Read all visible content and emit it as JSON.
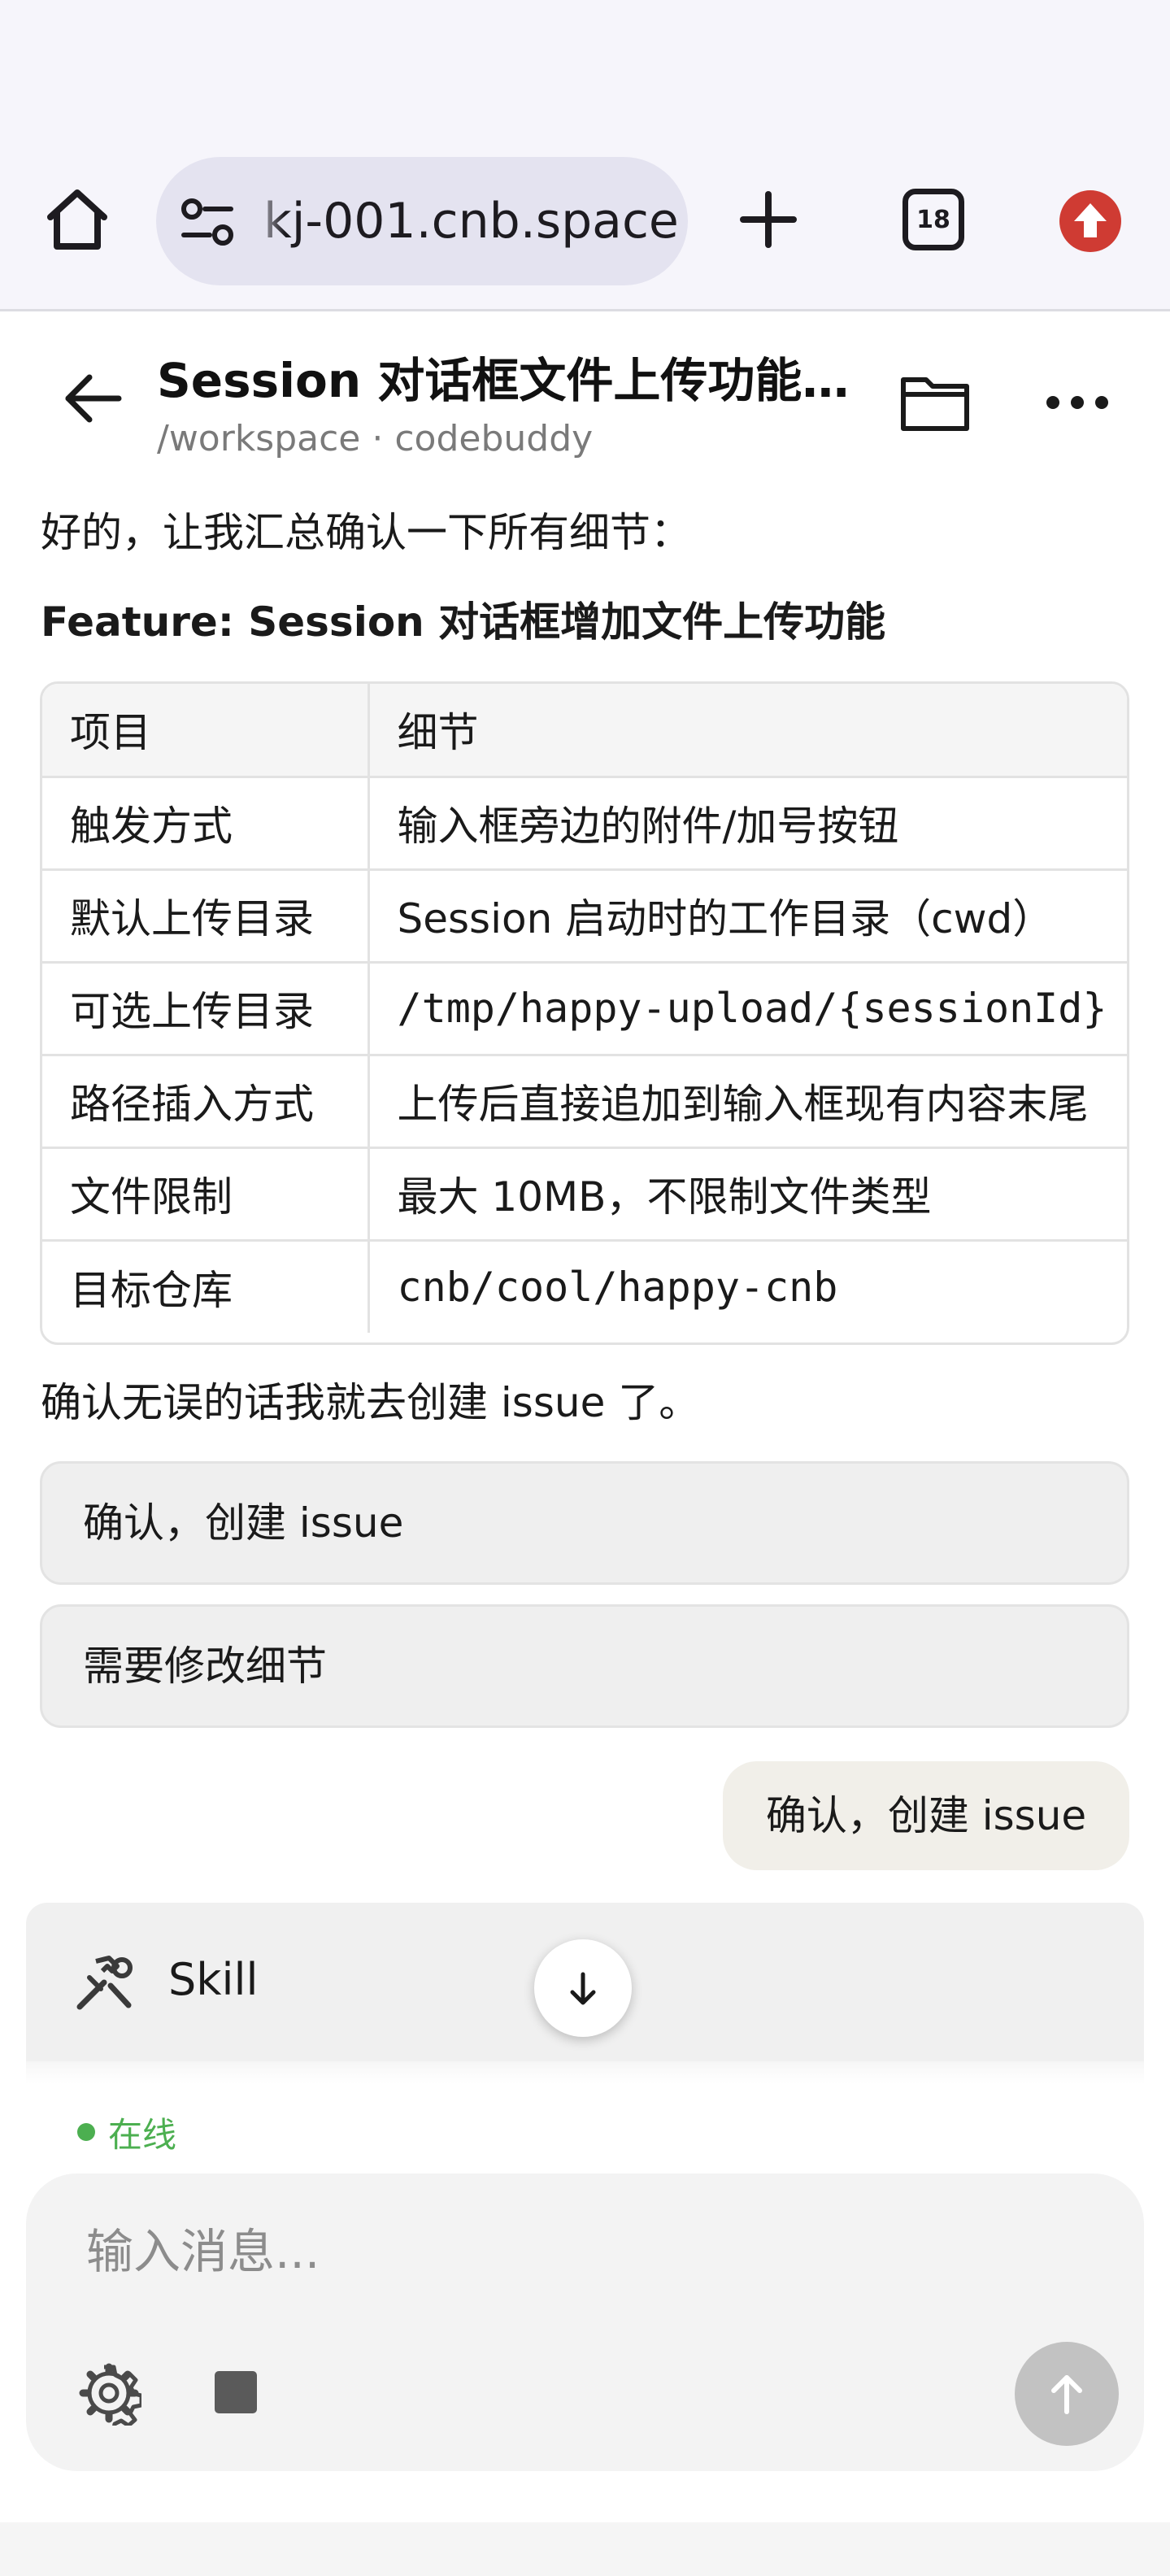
{
  "browser": {
    "url": "kj-001.cnb.space",
    "tab_count": "18"
  },
  "header": {
    "title": "Session 对话框文件上传功能设计",
    "subtitle": "/workspace · codebuddy"
  },
  "message": {
    "intro": "好的，让我汇总确认一下所有细节：",
    "heading": "Feature: Session 对话框增加文件上传功能",
    "table": {
      "headers": [
        "项目",
        "细节"
      ],
      "rows": [
        [
          "触发方式",
          "输入框旁边的附件/加号按钮"
        ],
        [
          "默认上传目录",
          "Session 启动时的工作目录（cwd）"
        ],
        [
          "可选上传目录",
          "/tmp/happy-upload/{sessionId}"
        ],
        [
          "路径插入方式",
          "上传后直接追加到输入框现有内容末尾"
        ],
        [
          "文件限制",
          "最大 10MB，不限制文件类型"
        ],
        [
          "目标仓库",
          "cnb/cool/happy-cnb"
        ]
      ]
    },
    "confirm": "确认无误的话我就去创建 issue 了。",
    "options": [
      "确认，创建 issue",
      "需要修改细节"
    ]
  },
  "user_reply": "确认，创建 issue",
  "tool": {
    "label": "Skill",
    "icon": "tools-icon"
  },
  "status": {
    "text": "在线",
    "color": "#4caf50"
  },
  "composer": {
    "placeholder": "输入消息..."
  },
  "colors": {
    "update_badge": "#cf3b33",
    "send_disabled": "#c2c2c2"
  }
}
